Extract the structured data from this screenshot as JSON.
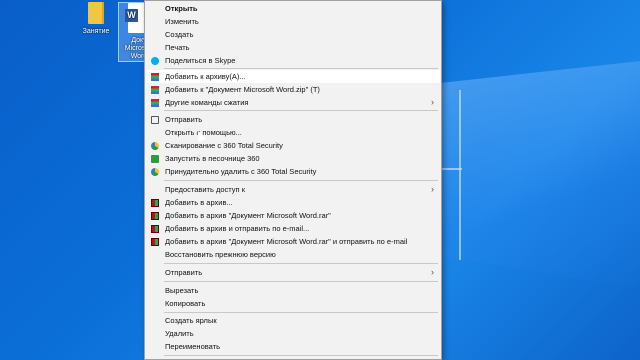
{
  "desktop": {
    "icons": [
      {
        "label": "Занятие",
        "type": "folder-icon"
      },
      {
        "label": "Доку Microsoft Word",
        "type": "word-document-icon"
      }
    ]
  },
  "menu": {
    "items": [
      {
        "label": "Открыть",
        "bold": true
      },
      {
        "label": "Изменить"
      },
      {
        "label": "Создать"
      },
      {
        "label": "Печать"
      },
      {
        "label": "Поделиться в Skype",
        "icon": "skype-icon"
      },
      {
        "label": "Добавить к архиву(A)...",
        "icon": "winrar-icon"
      },
      {
        "label": "Добавить к \"Документ Microsoft Word.zip\" (T)",
        "icon": "winrar-icon"
      },
      {
        "label": "Другие команды сжатия",
        "icon": "winrar-icon",
        "submenu": true
      },
      {
        "label": "Отправить",
        "icon": "share-icon"
      },
      {
        "label": "Открыть с помощью..."
      },
      {
        "label": "Сканирование с 360 Total Security",
        "icon": "360-icon"
      },
      {
        "label": "Запустить в песочнице 360",
        "icon": "sandbox-icon"
      },
      {
        "label": "Принудительно удалить с 360 Total Security",
        "icon": "360-icon"
      },
      {
        "label": "Предоставить доступ к",
        "submenu": true
      },
      {
        "label": "Добавить в архив...",
        "icon": "rar-icon"
      },
      {
        "label": "Добавить в архив \"Документ Microsoft Word.rar\"",
        "icon": "rar-icon"
      },
      {
        "label": "Добавить в архив и отправить по e-mail...",
        "icon": "rar-icon"
      },
      {
        "label": "Добавить в архив \"Документ Microsoft Word.rar\" и отправить по e-mail",
        "icon": "rar-icon"
      },
      {
        "label": "Восстановить прежнюю версию"
      },
      {
        "label": "Отправить",
        "submenu": true
      },
      {
        "label": "Вырезать"
      },
      {
        "label": "Копировать"
      },
      {
        "label": "Создать ярлык"
      },
      {
        "label": "Удалить"
      },
      {
        "label": "Переименовать"
      }
    ]
  },
  "colors": {
    "desktop": "#0b6fd8",
    "menu_bg": "#f2f2f2",
    "highlight": "#ffffff"
  },
  "arrow_glyph": "›"
}
